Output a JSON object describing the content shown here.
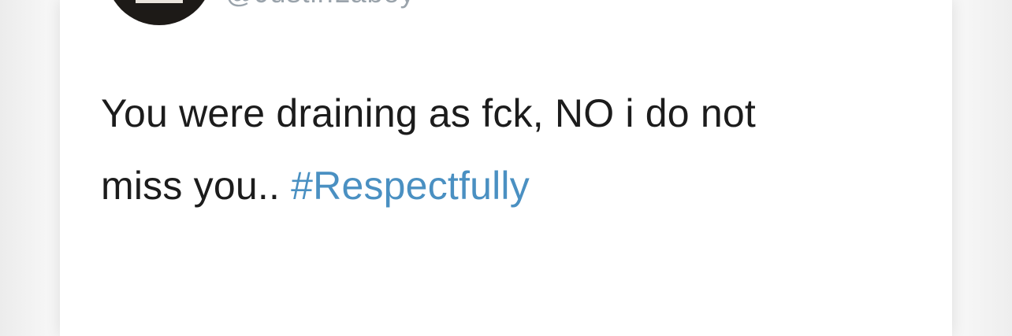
{
  "tweet": {
    "handle": "@JustinLaboy",
    "text_line1": "You were draining as fck, NO i do not",
    "text_line2": "miss you..",
    "hashtag": "#Respectfully"
  },
  "colors": {
    "hashtag": "#4a90c2",
    "text": "#1c1c1c",
    "handle": "#9aa3ab"
  },
  "icons": {
    "avatar": "profile-avatar"
  }
}
